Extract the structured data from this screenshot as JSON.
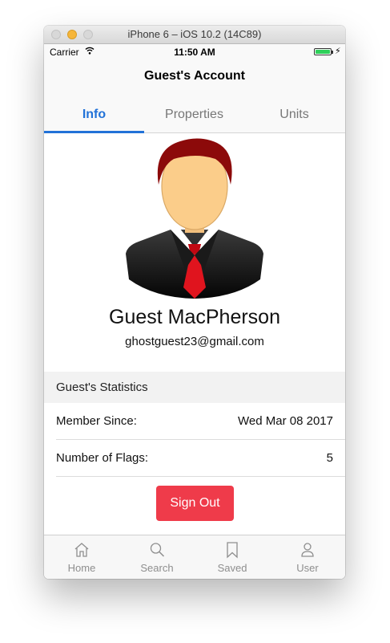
{
  "window": {
    "title": "iPhone 6 – iOS 10.2 (14C89)"
  },
  "status_bar": {
    "carrier": "Carrier",
    "time": "11:50 AM",
    "battery_color": "#2fd05a"
  },
  "nav": {
    "title": "Guest's Account"
  },
  "tabs": [
    {
      "label": "Info",
      "selected": true
    },
    {
      "label": "Properties",
      "selected": false
    },
    {
      "label": "Units",
      "selected": false
    }
  ],
  "profile": {
    "name": "Guest MacPherson",
    "email": "ghostguest23@gmail.com",
    "avatar_icon": "businessman-avatar"
  },
  "statistics": {
    "header": "Guest's Statistics",
    "rows": [
      {
        "label": "Member Since:",
        "value": "Wed Mar 08 2017"
      },
      {
        "label": "Number of Flags:",
        "value": "5"
      }
    ]
  },
  "sign_out": {
    "label": "Sign Out",
    "color": "#ef3b4a"
  },
  "tab_bar": [
    {
      "label": "Home",
      "icon": "home-icon"
    },
    {
      "label": "Search",
      "icon": "search-icon"
    },
    {
      "label": "Saved",
      "icon": "bookmark-icon"
    },
    {
      "label": "User",
      "icon": "user-icon"
    }
  ],
  "colors": {
    "accent": "#2272d8",
    "danger": "#ef3b4a"
  }
}
